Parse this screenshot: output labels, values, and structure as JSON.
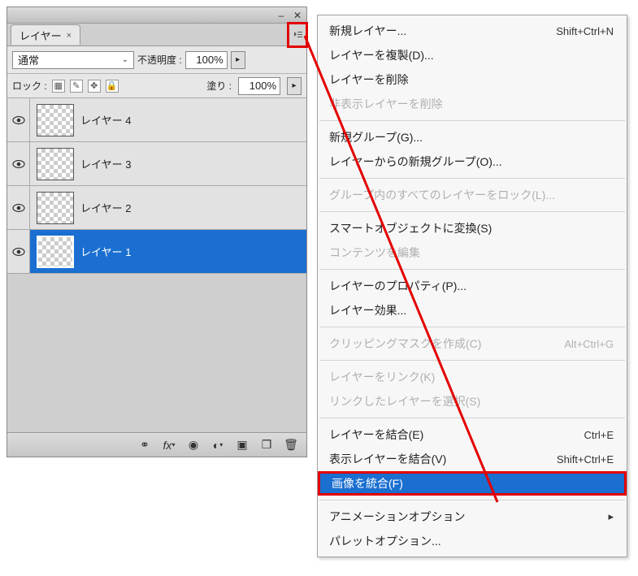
{
  "panel": {
    "tab_label": "レイヤー",
    "blend_mode": "通常",
    "opacity_label": "不透明度 :",
    "opacity_value": "100%",
    "lock_label": "ロック :",
    "fill_label": "塗り :",
    "fill_value": "100%",
    "layers": [
      {
        "name": "レイヤー 4",
        "selected": false
      },
      {
        "name": "レイヤー 3",
        "selected": false
      },
      {
        "name": "レイヤー 2",
        "selected": false
      },
      {
        "name": "レイヤー 1",
        "selected": true
      }
    ]
  },
  "menu": {
    "items": [
      {
        "label": "新規レイヤー...",
        "shortcut": "Shift+Ctrl+N",
        "disabled": false
      },
      {
        "label": "レイヤーを複製(D)...",
        "disabled": false
      },
      {
        "label": "レイヤーを削除",
        "disabled": false
      },
      {
        "label": "非表示レイヤーを削除",
        "disabled": true
      },
      {
        "sep": true
      },
      {
        "label": "新規グループ(G)...",
        "disabled": false
      },
      {
        "label": "レイヤーからの新規グループ(O)...",
        "disabled": false
      },
      {
        "sep": true
      },
      {
        "label": "グループ内のすべてのレイヤーをロック(L)...",
        "disabled": true
      },
      {
        "sep": true
      },
      {
        "label": "スマートオブジェクトに変換(S)",
        "disabled": false
      },
      {
        "label": "コンテンツを編集",
        "disabled": true
      },
      {
        "sep": true
      },
      {
        "label": "レイヤーのプロパティ(P)...",
        "disabled": false
      },
      {
        "label": "レイヤー効果...",
        "disabled": false
      },
      {
        "sep": true
      },
      {
        "label": "クリッピングマスクを作成(C)",
        "shortcut": "Alt+Ctrl+G",
        "disabled": true
      },
      {
        "sep": true
      },
      {
        "label": "レイヤーをリンク(K)",
        "disabled": true
      },
      {
        "label": "リンクしたレイヤーを選択(S)",
        "disabled": true
      },
      {
        "sep": true
      },
      {
        "label": "レイヤーを結合(E)",
        "shortcut": "Ctrl+E",
        "disabled": false
      },
      {
        "label": "表示レイヤーを結合(V)",
        "shortcut": "Shift+Ctrl+E",
        "disabled": false
      },
      {
        "label": "画像を統合(F)",
        "disabled": false,
        "selected": true,
        "highlight": true
      },
      {
        "sep": true
      },
      {
        "label": "アニメーションオプション",
        "submenu": true,
        "disabled": false
      },
      {
        "label": "パレットオプション...",
        "disabled": false
      }
    ]
  }
}
